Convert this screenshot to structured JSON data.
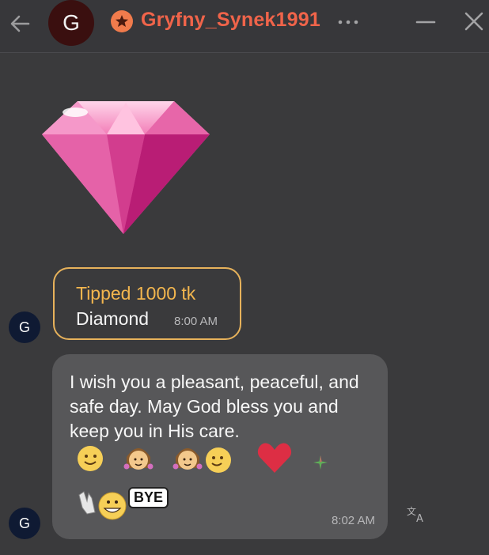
{
  "header": {
    "avatar_letter": "G",
    "username": "Gryfny_Synek1991",
    "icons": [
      "back-arrow-icon",
      "star-badge-icon",
      "more-dots-icon",
      "minimize-icon",
      "close-icon"
    ]
  },
  "messages": {
    "sticker": "diamond-sticker",
    "tip": {
      "title": "Tipped 1000 tk",
      "gift": "Diamond",
      "time": "8:00 AM"
    },
    "text": {
      "body": "I wish you a pleasant, peaceful, and safe day. May God bless you and keep you in His care.",
      "bye_label": "BYE",
      "time": "8:02 AM"
    },
    "sender_avatar_letter": "G"
  },
  "colors": {
    "background": "#3a3a3c",
    "username": "#f0644a",
    "tip_border": "#e7b25b",
    "tip_title": "#f3b64e",
    "bubble": "#575759"
  }
}
